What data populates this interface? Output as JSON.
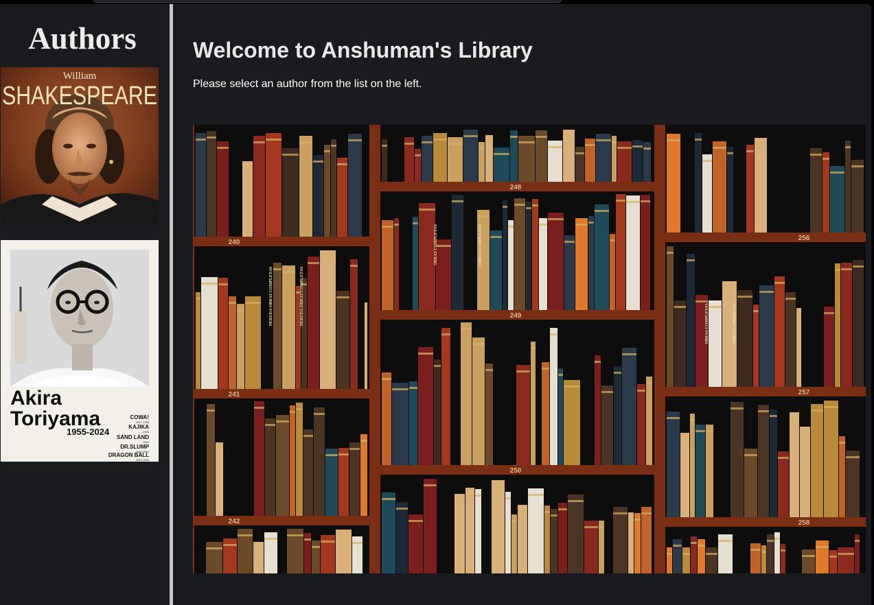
{
  "sidebar": {
    "title": "Authors",
    "authors": [
      {
        "id": "shakespeare",
        "cover_first_name": "William",
        "cover_last_name": "SHAKESPEARE"
      },
      {
        "id": "toriyama",
        "cover_name_line1": "Akira",
        "cover_name_line2": "Toriyama",
        "cover_years": "1955-2024",
        "cover_works": [
          {
            "title": "COWA!",
            "year": "1997-1998"
          },
          {
            "title": "KAJIKA",
            "year": "1998"
          },
          {
            "title": "SAND LAND",
            "year": "2000"
          },
          {
            "title": "DR.SLUMP",
            "year": "1980-1984"
          },
          {
            "title": "DRAGON BALL",
            "year": "1984-1995"
          }
        ]
      }
    ]
  },
  "main": {
    "title": "Welcome to Anshuman's Library",
    "subtitle": "Please select an author from the list on the left."
  },
  "hero": {
    "shelf_labels": [
      "240",
      "241",
      "242",
      "248",
      "249",
      "250",
      "256",
      "257",
      "258"
    ],
    "spine_texts": [
      "NERUDA OBRAS COMPLETAS",
      "NERUDA OBRAS COMPLETAS",
      "OBRAS COMPLETAS",
      "OBRAS COMPLETAS",
      "OBRAS COMPLETAS",
      "OBRAS COMPLETAS"
    ],
    "colors": {
      "wood": "#7a2e14",
      "shadow": "#0d0d0d"
    }
  }
}
